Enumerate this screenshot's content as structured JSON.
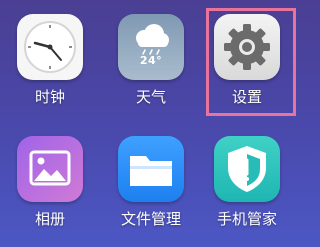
{
  "apps": [
    {
      "id": "clock",
      "label": "时钟",
      "icon": "clock-icon"
    },
    {
      "id": "weather",
      "label": "天气",
      "icon": "weather-icon",
      "temperature": "24°"
    },
    {
      "id": "settings",
      "label": "设置",
      "icon": "gear-icon",
      "highlighted": true
    },
    {
      "id": "gallery",
      "label": "相册",
      "icon": "photo-icon"
    },
    {
      "id": "files",
      "label": "文件管理",
      "icon": "folder-icon"
    },
    {
      "id": "manager",
      "label": "手机管家",
      "icon": "shield-icon"
    }
  ],
  "colors": {
    "highlight": "#e9739a",
    "wallpaper_top": "#4a3f93",
    "wallpaper_bottom": "#4c57c4"
  }
}
